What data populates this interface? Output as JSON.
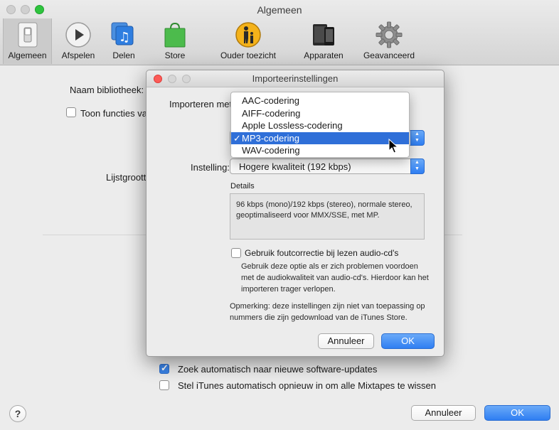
{
  "window": {
    "title": "Algemeen",
    "toolbar": [
      {
        "label": "Algemeen",
        "icon": "switch-icon"
      },
      {
        "label": "Afspelen",
        "icon": "play-icon"
      },
      {
        "label": "Delen",
        "icon": "music-share-icon"
      },
      {
        "label": "Store",
        "icon": "shopping-bag-icon"
      },
      {
        "label": "Ouder toezicht",
        "icon": "parental-icon"
      },
      {
        "label": "Apparaten",
        "icon": "devices-icon"
      },
      {
        "label": "Geavanceerd",
        "icon": "gear-icon"
      }
    ]
  },
  "background": {
    "library_name_label": "Naam bibliotheek:",
    "show_functions_label": "Toon functies van",
    "list_size_label": "Lijstgrootte",
    "updates_label": "Zoek automatisch naar nieuwe software-updates",
    "updates_checked": true,
    "mixtapes_label": "Stel iTunes automatisch opnieuw in om alle Mixtapes te wissen",
    "mixtapes_checked": false,
    "help_label": "?",
    "cancel_label": "Annuleer",
    "ok_label": "OK"
  },
  "dialog": {
    "title": "Importeerinstellingen",
    "import_with_label": "Importeren met:",
    "setting_label": "Instelling:",
    "setting_value": "Hogere kwaliteit (192 kbps)",
    "details_label": "Details",
    "details_text": "96 kbps (mono)/192 kbps (stereo), normale stereo, geoptimaliseerd voor MMX/SSE, met MP.",
    "error_correction_label": "Gebruik foutcorrectie bij lezen audio-cd's",
    "error_correction_checked": false,
    "error_correction_help": "Gebruik deze optie als er zich problemen voordoen met de audiokwaliteit van audio-cd's. Hierdoor kan het importeren trager verlopen.",
    "note": "Opmerking: deze instellingen zijn niet van toepassing op nummers die zijn gedownload van de iTunes Store.",
    "cancel_label": "Annuleer",
    "ok_label": "OK"
  },
  "encoder_menu": {
    "items": [
      "AAC-codering",
      "AIFF-codering",
      "Apple Lossless-codering",
      "MP3-codering",
      "WAV-codering"
    ],
    "selected": "MP3-codering",
    "check_mark": "✓"
  },
  "colors": {
    "accent": "#2f7ef2",
    "selection": "#2f6fd8"
  }
}
